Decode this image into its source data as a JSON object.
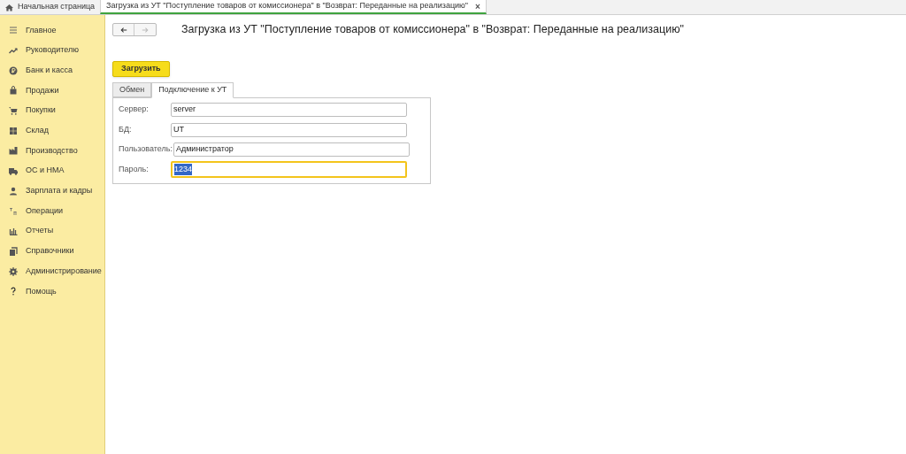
{
  "tabs": [
    {
      "label": "Начальная страница",
      "kind": "home",
      "selected": false
    },
    {
      "label": "Загрузка из УТ \"Поступление товаров от комиссионера\" в \"Возврат: Переданные на реализацию\"",
      "kind": "document",
      "selected": true,
      "close": "×"
    }
  ],
  "sidebar": {
    "items": [
      {
        "label": "Главное"
      },
      {
        "label": "Руководителю"
      },
      {
        "label": "Банк и касса"
      },
      {
        "label": "Продажи"
      },
      {
        "label": "Покупки"
      },
      {
        "label": "Склад"
      },
      {
        "label": "Производство"
      },
      {
        "label": "ОС и НМА"
      },
      {
        "label": "Зарплата и кадры"
      },
      {
        "label": "Операции"
      },
      {
        "label": "Отчеты"
      },
      {
        "label": "Справочники"
      },
      {
        "label": "Администрирование"
      },
      {
        "label": "Помощь"
      }
    ]
  },
  "form": {
    "title": "Загрузка из УТ \"Поступление товаров от комиссионера\" в \"Возврат: Переданные на реализацию\"",
    "back_enabled": true,
    "forward_enabled": false,
    "load_button": "Загрузить",
    "tabs": [
      {
        "label": "Обмен",
        "selected": false
      },
      {
        "label": "Подключение к УТ",
        "selected": true
      }
    ],
    "fields": [
      {
        "label": "Сервер:",
        "value": "server",
        "focused": false
      },
      {
        "label": "БД:",
        "value": "UT",
        "focused": false
      },
      {
        "label": "Пользователь:",
        "value": "Администратор",
        "focused": false
      },
      {
        "label": "Пароль:",
        "value": "1234",
        "focused": true
      }
    ]
  }
}
